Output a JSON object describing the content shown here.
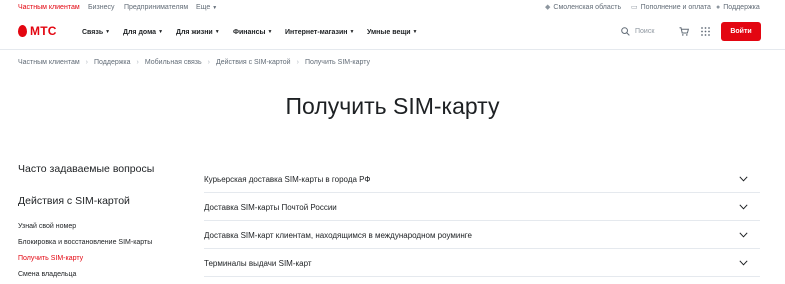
{
  "topbar": {
    "segments": [
      "Частным клиентам",
      "Бизнесу",
      "Предпринимателям",
      "Еще"
    ],
    "region": "Смоленская область",
    "topup": "Пополнение и оплата",
    "support": "Поддержка"
  },
  "header": {
    "logo": "МТС",
    "nav": [
      "Связь",
      "Для дома",
      "Для жизни",
      "Финансы",
      "Интернет-магазин",
      "Умные вещи"
    ],
    "search_placeholder": "Поиск",
    "login": "Войти"
  },
  "breadcrumbs": [
    "Частным клиентам",
    "Поддержка",
    "Мобильная связь",
    "Действия с SIM-картой",
    "Получить SIM-карту"
  ],
  "page_title": "Получить SIM-карту",
  "sidebar": {
    "faq": "Часто задаваемые вопросы",
    "section_title": "Действия с SIM-картой",
    "links": [
      "Узнай свой номер",
      "Блокировка и восстановление SIM-карты",
      "Получить SIM-карту",
      "Смена владельца"
    ],
    "active_index": 2
  },
  "accordion": [
    "Курьерская доставка SIM-карты в города РФ",
    "Доставка SIM-карты Почтой России",
    "Доставка SIM-карт клиентам, находящимся в международном роуминге",
    "Терминалы выдачи SIM-карт"
  ],
  "colors": {
    "brand": "#e30611",
    "text": "#1d2023",
    "muted": "#626c77",
    "divider": "#e5e9ee"
  }
}
